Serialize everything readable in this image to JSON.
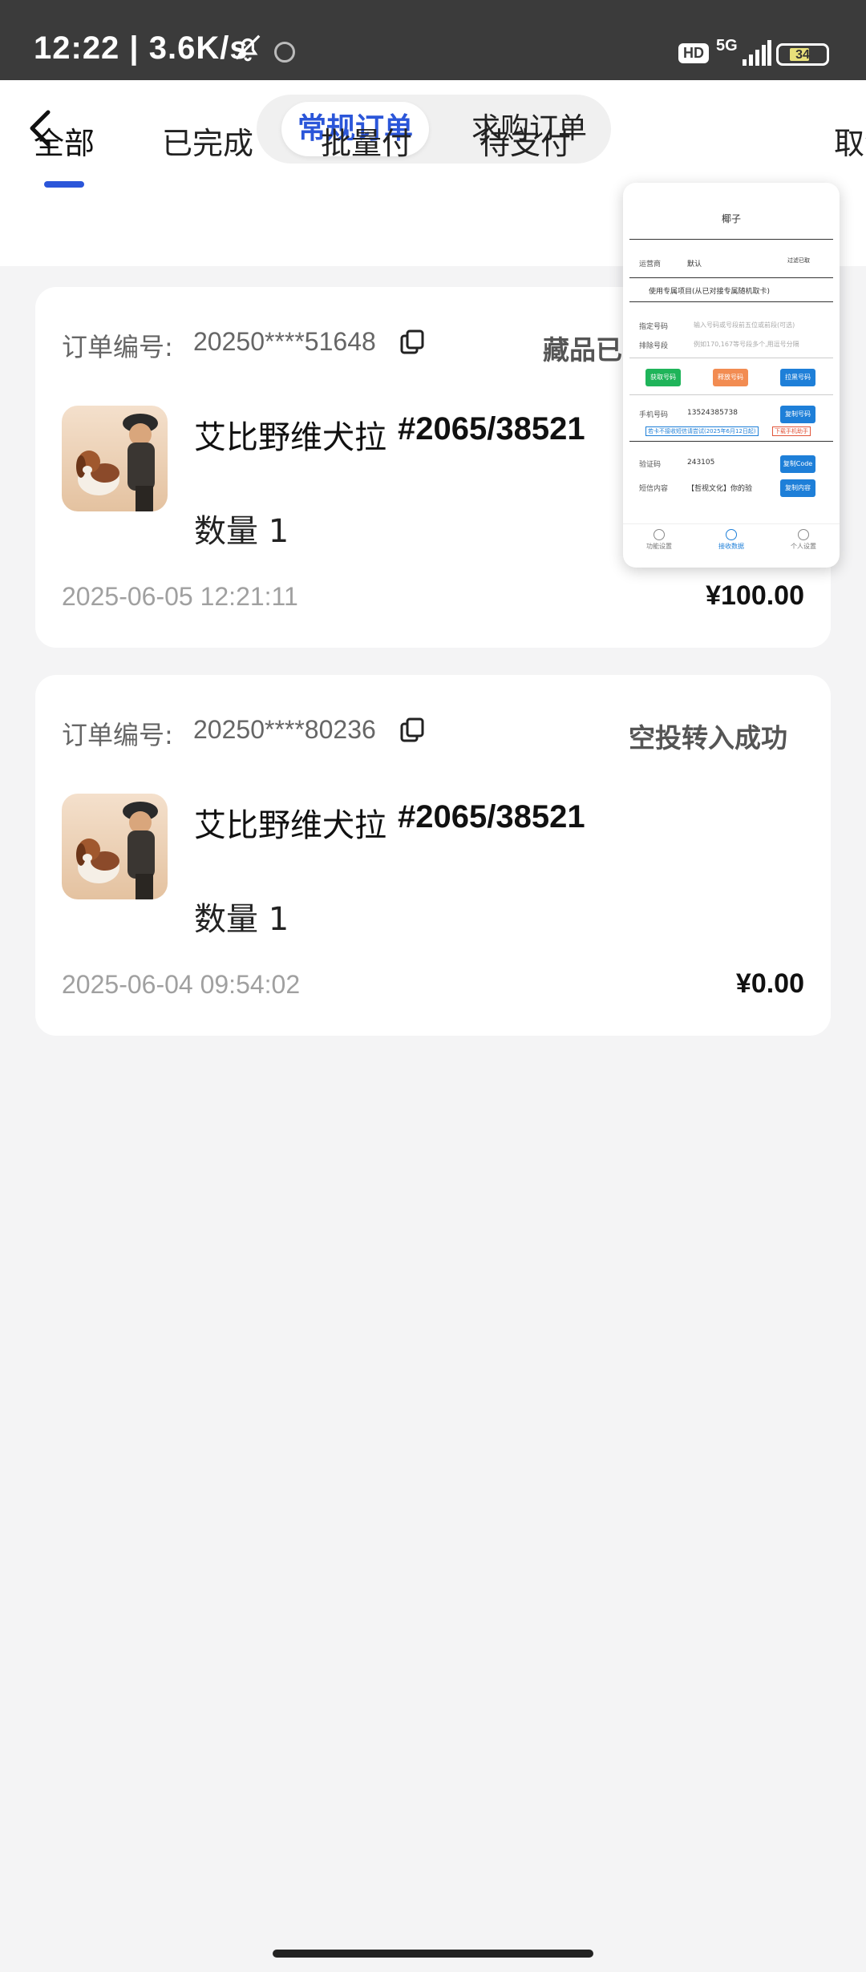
{
  "status_bar": {
    "time": "12:22 | 3.6K/s",
    "hd": "HD",
    "network": "5G",
    "battery": "34"
  },
  "header": {
    "segments": [
      "常规订单",
      "求购订单"
    ],
    "active_segment": "常规订单"
  },
  "tabs": [
    {
      "label": "全部",
      "active": true
    },
    {
      "label": "已完成",
      "active": false
    },
    {
      "label": "批量付",
      "active": false
    },
    {
      "label": "待支付",
      "active": false
    },
    {
      "label": "取消",
      "active": false
    }
  ],
  "orders": [
    {
      "order_label": "订单编号:",
      "order_id": "20250****51648",
      "status": "藏品已",
      "title": "艾比野维犬拉",
      "edition": "#2065/38521",
      "quantity": "数量 1",
      "time": "2025-06-05 12:21:11",
      "price": "¥100.00"
    },
    {
      "order_label": "订单编号:",
      "order_id": "20250****80236",
      "status": "空投转入成功",
      "title": "艾比野维犬拉",
      "edition": "#2065/38521",
      "quantity": "数量 1",
      "time": "2025-06-04 09:54:02",
      "price": "¥0.00"
    }
  ],
  "float_window": {
    "title": "椰子",
    "operator_label": "运营商",
    "operator_value": "默认",
    "filter_label": "过滤已取",
    "use_project": "使用专属项目(从已对接专属随机取卡)",
    "specify_label": "指定号码",
    "specify_placeholder": "输入号码或号段前五位或前段(可选)",
    "exclude_label": "排除号段",
    "exclude_placeholder": "例如170,167等号段多个,用逗号分隔",
    "btn_get": "获取号码",
    "btn_release": "释放号码",
    "btn_block": "拉黑号码",
    "phone_label": "手机号码",
    "phone_value": "13524385738",
    "btn_copy_phone": "复制号码",
    "note_left": "若卡不接收短信请尝试(2025年6月12日起)",
    "note_right": "下载手机助手",
    "code_label": "验证码",
    "code_value": "243105",
    "btn_copy_code": "复制Code",
    "sms_label": "短信内容",
    "sms_value": "【哲视文化】你的验",
    "btn_copy_sms": "复制内容",
    "nav": [
      "功能设置",
      "接收数据",
      "个人设置"
    ]
  },
  "colors": {
    "accent": "#2b56d9",
    "status_bar": "#3b3b3b",
    "background": "#f4f4f5",
    "green": "#1fb45a",
    "orange": "#f28c52",
    "blue": "#1e7fd8"
  }
}
